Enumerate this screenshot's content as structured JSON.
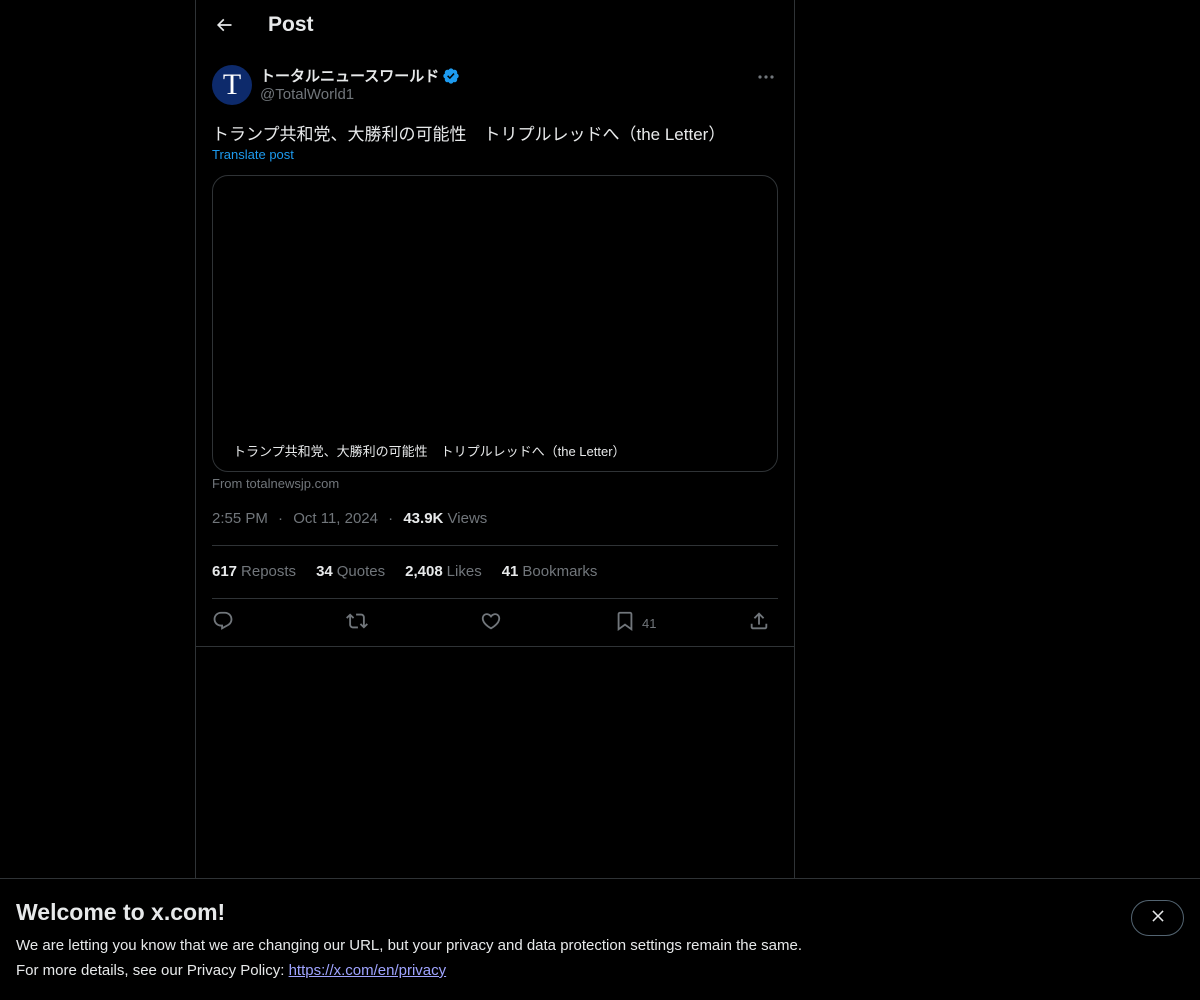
{
  "header": {
    "title": "Post",
    "back_icon": "arrow-left-icon"
  },
  "author": {
    "avatar_letter": "T",
    "name": "トータルニュースワールド",
    "handle": "@TotalWorld1",
    "verified": true,
    "verified_color": "#1d9bf0"
  },
  "post": {
    "text": "トランプ共和党、大勝利の可能性　トリプルレッドへ（the Letter）",
    "translate_label": "Translate post",
    "card": {
      "caption": "トランプ共和党、大勝利の可能性　トリプルレッドへ（the Letter）",
      "source": "From totalnewsjp.com"
    },
    "time": "2:55 PM",
    "date": "Oct 11, 2024",
    "views_count": "43.9K",
    "views_label": "Views",
    "separator": "·"
  },
  "stats": [
    {
      "num": "617",
      "label": "Reposts"
    },
    {
      "num": "34",
      "label": "Quotes"
    },
    {
      "num": "2,408",
      "label": "Likes"
    },
    {
      "num": "41",
      "label": "Bookmarks"
    }
  ],
  "actions": {
    "reply_icon": "reply-icon",
    "repost_icon": "repost-icon",
    "like_icon": "heart-icon",
    "bookmark_icon": "bookmark-icon",
    "bookmark_count": "41",
    "share_icon": "share-icon"
  },
  "banner": {
    "title": "Welcome to x.com!",
    "line1": "We are letting you know that we are changing our URL, but your privacy and data protection settings remain the same.",
    "line2_prefix": "For more details, see our Privacy Policy: ",
    "link": "https://x.com/en/privacy",
    "close_icon": "close-icon"
  },
  "colors": {
    "background": "#000000",
    "text": "#e7e9ea",
    "muted": "#71767b",
    "accent": "#1d9bf0",
    "border": "#2f3336",
    "link": "#9fa4ff"
  }
}
